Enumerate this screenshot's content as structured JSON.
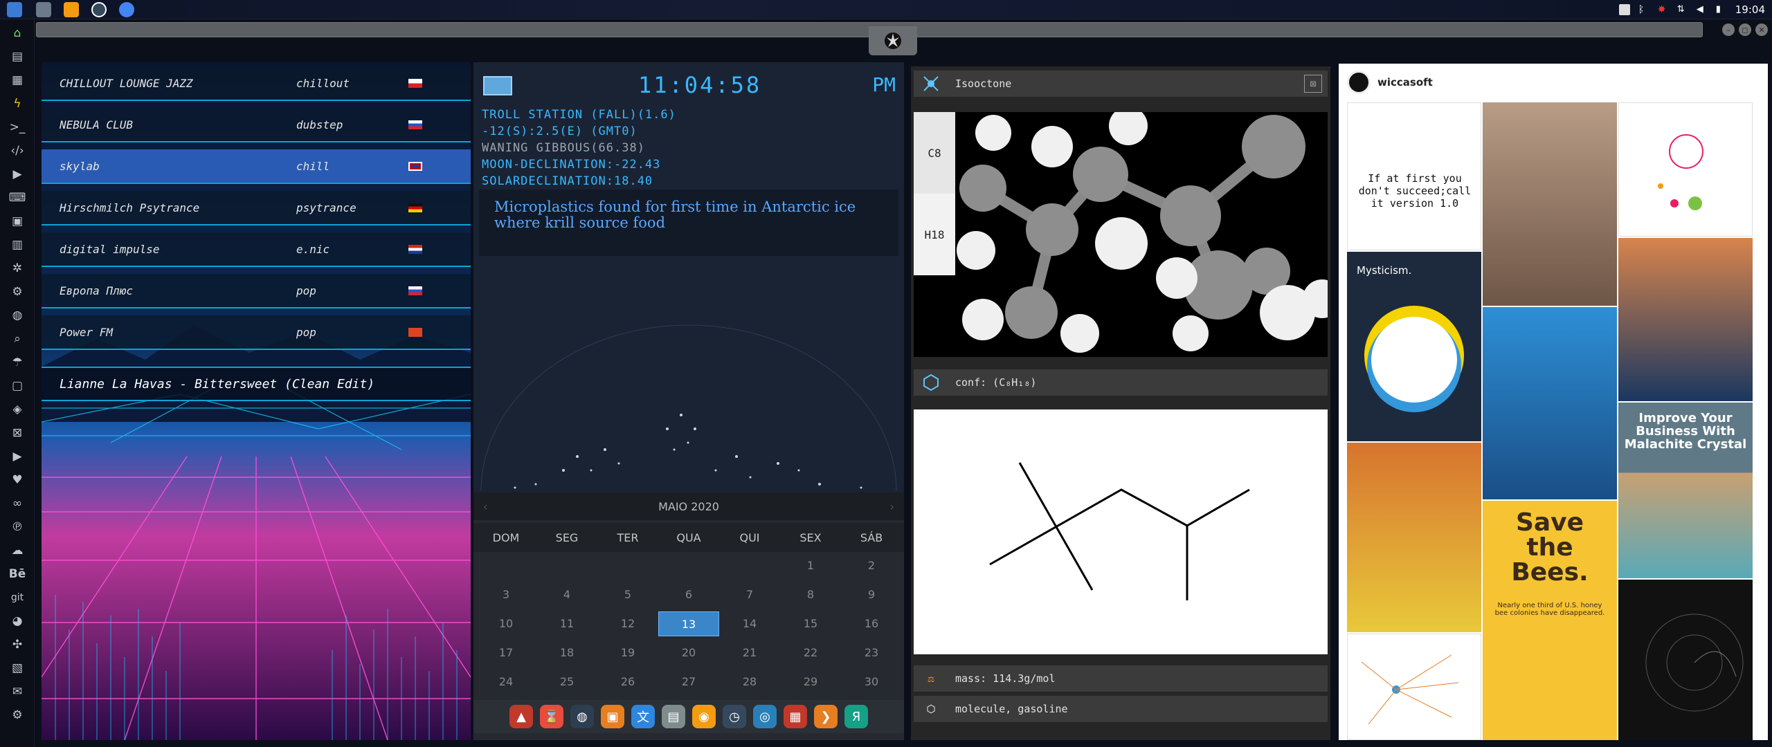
{
  "topbar": {
    "clock": "19:04",
    "apps": [
      "files-icon",
      "desktop-icon",
      "sublime-icon",
      "vnc-icon",
      "chrome-icon"
    ]
  },
  "window": {
    "controls": [
      "–",
      "◻",
      "✕"
    ]
  },
  "dock_left": {
    "items": [
      "home-icon",
      "files-icon",
      "notes-icon",
      "bolt-icon",
      "terminal-icon",
      "code-icon",
      "media-icon",
      "keyboard-icon",
      "photos-icon",
      "doc-icon",
      "star-icon",
      "steam-icon",
      "globe-icon",
      "search-icon",
      "umbrella-icon",
      "contacts-icon",
      "cloud-tag-icon",
      "network-icon",
      "youtube-icon",
      "heart-icon",
      "link-icon",
      "pinterest-icon",
      "cloud-icon",
      "behance-icon",
      "git-icon",
      "github-icon",
      "puzzle-icon",
      "map-icon",
      "mail-icon",
      "settings-icon"
    ],
    "labels": {
      "behance": "Bē",
      "git": "git"
    }
  },
  "radio": {
    "stations": [
      {
        "name": "CHILLOUT LOUNGE JAZZ",
        "genre": "chillout",
        "flag": "pl"
      },
      {
        "name": "NEBULA CLUB",
        "genre": "dubstep",
        "flag": "ru"
      },
      {
        "name": "skylab",
        "genre": "chill",
        "flag": "uk"
      },
      {
        "name": "Hirschmilch Psytrance",
        "genre": "psytrance",
        "flag": "de"
      },
      {
        "name": "digital impulse",
        "genre": "e.nic",
        "flag": "hr"
      },
      {
        "name": "Европа Плюс",
        "genre": "pop",
        "flag": "ru"
      },
      {
        "name": "Power FM",
        "genre": "pop",
        "flag": "tr"
      }
    ],
    "active_index": 2,
    "now_playing": "Lianne La Havas - Bittersweet (Clean Edit)"
  },
  "astro": {
    "clock": "11:04:58",
    "ampm": "PM",
    "lines": [
      "TROLL STATION (FALL)(1.6)",
      "-12(S):2.5(E) (GMT0)",
      "WANING GIBBOUS(66.38)",
      "MOON-DECLINATION:-22.43",
      "SOLARDECLINATION:18.40"
    ],
    "news": "Microplastics found for first time in Antarctic ice where krill source food"
  },
  "calendar": {
    "month": "MAIO 2020",
    "weekdays": [
      "DOM",
      "SEG",
      "TER",
      "QUA",
      "QUI",
      "SEX",
      "SÁB"
    ],
    "rows": [
      [
        "",
        "",
        "",
        "",
        "",
        "1",
        "2"
      ],
      [
        "3",
        "4",
        "5",
        "6",
        "7",
        "8",
        "9"
      ],
      [
        "10",
        "11",
        "12",
        "13",
        "14",
        "15",
        "16"
      ],
      [
        "17",
        "18",
        "19",
        "20",
        "21",
        "22",
        "23"
      ],
      [
        "24",
        "25",
        "26",
        "27",
        "28",
        "29",
        "30"
      ]
    ],
    "today": "13"
  },
  "bottom_dock": {
    "items": [
      {
        "name": "arch-icon",
        "glyph": "▲",
        "color": "#c0392b"
      },
      {
        "name": "hourglass-icon",
        "glyph": "⌛",
        "color": "#e74c3c"
      },
      {
        "name": "earth-icon",
        "glyph": "◍",
        "color": "#2c3e50"
      },
      {
        "name": "image-viewer-icon",
        "glyph": "▣",
        "color": "#e67e22"
      },
      {
        "name": "translate-icon",
        "glyph": "文",
        "color": "#2e86de"
      },
      {
        "name": "notes-icon",
        "glyph": "▤",
        "color": "#7f8c8d"
      },
      {
        "name": "search-app-icon",
        "glyph": "◉",
        "color": "#f39c12"
      },
      {
        "name": "clock-app-icon",
        "glyph": "◷",
        "color": "#34495e"
      },
      {
        "name": "browser-icon",
        "glyph": "◎",
        "color": "#2980b9"
      },
      {
        "name": "calendar-app-icon",
        "glyph": "▦",
        "color": "#c0392b"
      },
      {
        "name": "arrow-app-icon",
        "glyph": "❯",
        "color": "#e67e22"
      },
      {
        "name": "yandex-icon",
        "glyph": "Я",
        "color": "#16a085"
      }
    ]
  },
  "molecule": {
    "name": "Isooctone",
    "formula_top": "C8",
    "formula_bottom": "H18",
    "conf": "conf: (C₈H₁₈)",
    "mass": "mass: 114.3g/mol",
    "tags": "molecule, gasoline"
  },
  "gallery": {
    "user": "wiccasoft",
    "tiles": [
      {
        "kind": "text",
        "text": "If at first you don't succeed;call it version 1.0"
      },
      {
        "kind": "portrait",
        "color": "#8a6b55"
      },
      {
        "kind": "diagram"
      },
      {
        "kind": "mysticism",
        "title": "Mysticism."
      },
      {
        "kind": "photo",
        "color": "#2a86c9"
      },
      {
        "kind": "portrait",
        "color": "#c36a3a"
      },
      {
        "kind": "portrait",
        "color": "#d8b33a"
      },
      {
        "kind": "bees",
        "title": "Save the Bees.",
        "sub": "Nearly one third of U.S. honey bee colonies have disappeared."
      },
      {
        "kind": "crystal",
        "title": "Improve Your Business With Malachite Crystal"
      },
      {
        "kind": "radial"
      },
      {
        "kind": "dark"
      }
    ]
  }
}
